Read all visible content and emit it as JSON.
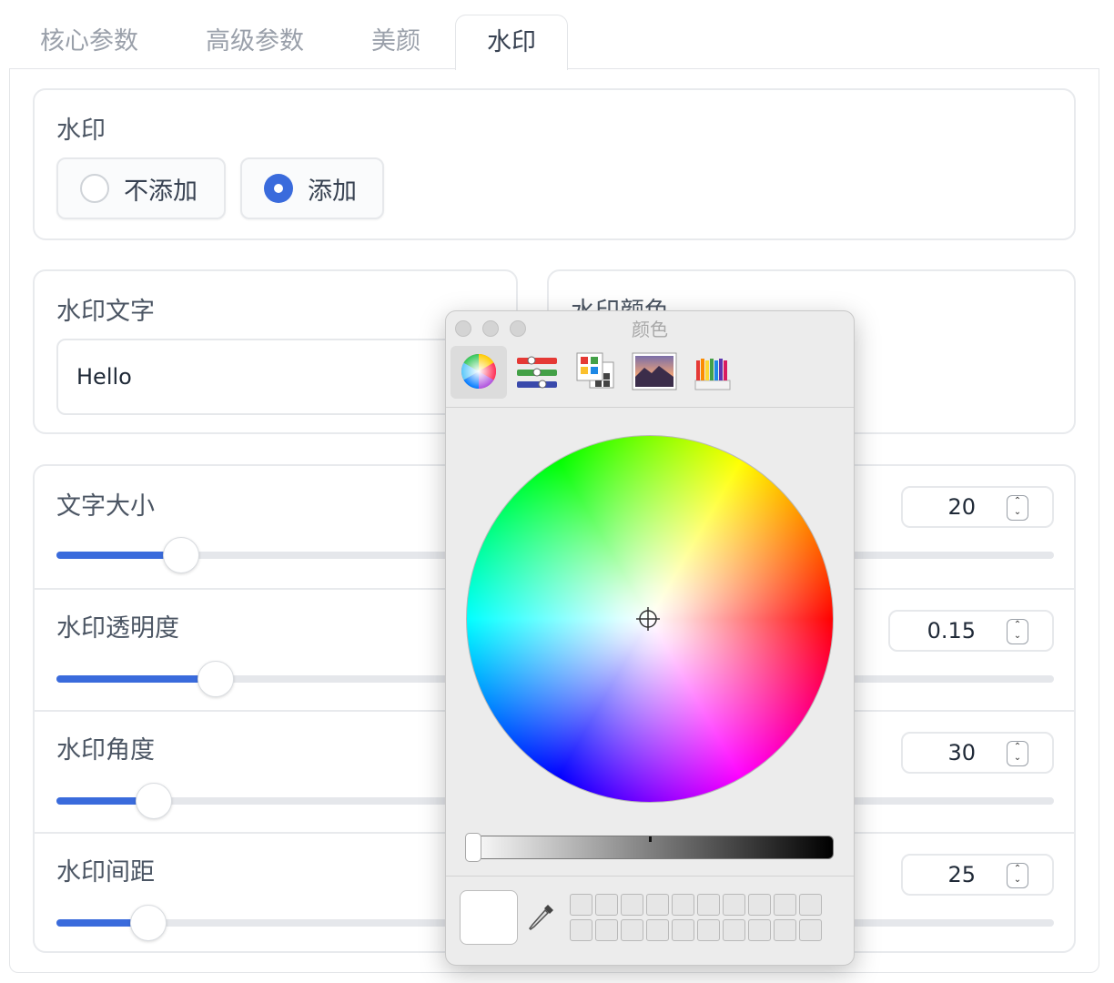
{
  "tabs": [
    {
      "label": "核心参数",
      "active": false
    },
    {
      "label": "高级参数",
      "active": false
    },
    {
      "label": "美颜",
      "active": false
    },
    {
      "label": "水印",
      "active": true
    }
  ],
  "watermark": {
    "title": "水印",
    "options": [
      {
        "label": "不添加",
        "checked": false
      },
      {
        "label": "添加",
        "checked": true
      }
    ],
    "accent_color": "#3a6bdc"
  },
  "watermark_text": {
    "label": "水印文字",
    "value": "Hello"
  },
  "watermark_color": {
    "label": "水印颜色"
  },
  "sliders": [
    {
      "label": "文字大小",
      "value": "20",
      "fill": 0.125
    },
    {
      "label": "水印透明度",
      "value": "0.15",
      "fill": 0.16
    },
    {
      "label": "水印角度",
      "value": "30",
      "fill": 0.098
    },
    {
      "label": "水印间距",
      "value": "25",
      "fill": 0.092
    }
  ],
  "color_picker": {
    "title": "颜色",
    "tools": [
      "color-wheel-icon",
      "sliders-icon",
      "palettes-icon",
      "image-palette-icon",
      "pencils-icon"
    ],
    "selected_color": "#ffffff",
    "brightness": 0.0
  }
}
